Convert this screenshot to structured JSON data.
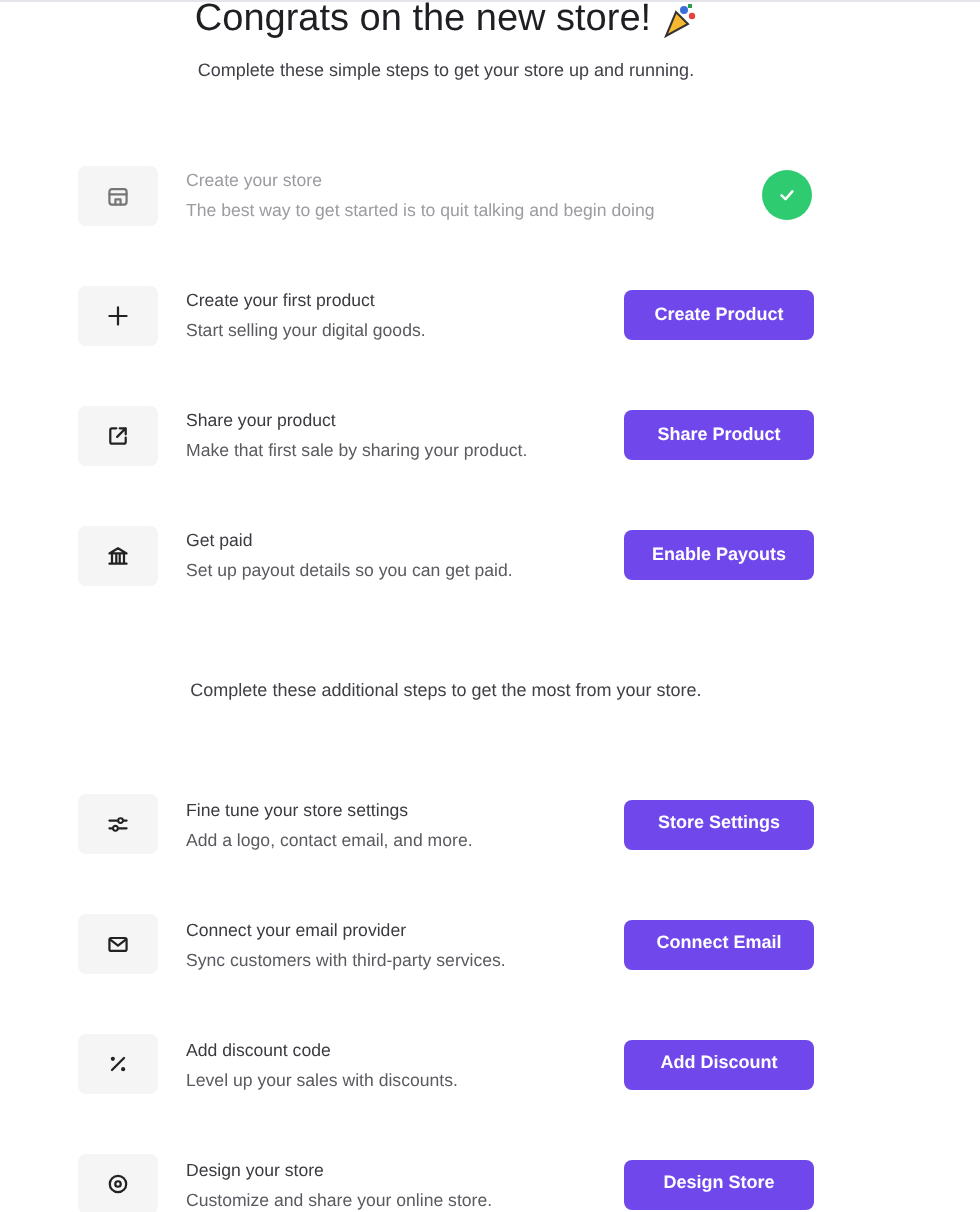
{
  "header": {
    "title": "Congrats on the new store!",
    "subtitle": "Complete these simple steps to get your store up and running."
  },
  "steps": [
    {
      "title": "Create your store",
      "description": "The best way to get started is to quit talking and begin doing",
      "done": true
    },
    {
      "title": "Create your first product",
      "description": "Start selling your digital goods.",
      "done": false,
      "button": "Create Product"
    },
    {
      "title": "Share your product",
      "description": "Make that first sale by sharing your product.",
      "done": false,
      "button": "Share Product"
    },
    {
      "title": "Get paid",
      "description": "Set up payout details so you can get paid.",
      "done": false,
      "button": "Enable Payouts"
    }
  ],
  "additional": {
    "subtitle": "Complete these additional steps to get the most from your store.",
    "steps": [
      {
        "title": "Fine tune your store settings",
        "description": "Add a logo, contact email, and more.",
        "done": false,
        "button": "Store Settings"
      },
      {
        "title": "Connect your email provider",
        "description": "Sync customers with third-party services.",
        "done": false,
        "button": "Connect Email"
      },
      {
        "title": "Add discount code",
        "description": "Level up your sales with discounts.",
        "done": false,
        "button": "Add Discount"
      },
      {
        "title": "Design your store",
        "description": "Customize and share your online store.",
        "done": false,
        "button": "Design Store"
      }
    ]
  }
}
